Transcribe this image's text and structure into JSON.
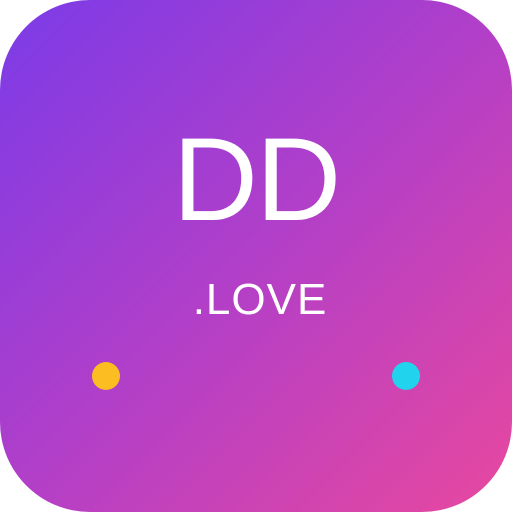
{
  "app_icon": {
    "title": "DD",
    "subtitle": ".LOVE",
    "gradient_start": "#7b3be8",
    "gradient_end": "#e8489e",
    "dots": [
      {
        "color": "#fbbd22"
      },
      {
        "color": "#22d3ee"
      }
    ]
  }
}
